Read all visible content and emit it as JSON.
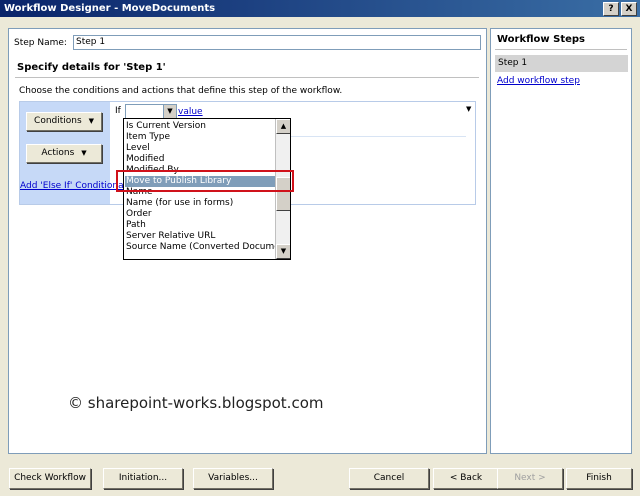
{
  "window": {
    "title": "Workflow Designer - MoveDocuments",
    "help_glyph": "?",
    "close_glyph": "X"
  },
  "step": {
    "name_label": "Step Name:",
    "name_value": "Step 1",
    "details_heading": "Specify details for 'Step 1'",
    "instructions": "Choose the conditions and actions that define this step of the workflow."
  },
  "condition": {
    "if_label": "If",
    "value_link": "value",
    "conditions_button": "Conditions",
    "actions_button": "Actions",
    "add_else_if": "Add 'Else If' Conditional Branch"
  },
  "dropdown": {
    "items": [
      "Is Current Version",
      "Item Type",
      "Level",
      "Modified",
      "Modified By",
      "Move to Publish Library",
      "Name",
      "Name (for use in forms)",
      "Order",
      "Path",
      "Server Relative URL",
      "Source Name (Converted Document)"
    ],
    "selected": "Move to Publish Library"
  },
  "sidebar": {
    "header": "Workflow Steps",
    "steps": [
      "Step 1"
    ],
    "add_link": "Add workflow step"
  },
  "watermark": "© sharepoint-works.blogspot.com",
  "footer": {
    "check_workflow": "Check Workflow",
    "initiation": "Initiation...",
    "variables": "Variables...",
    "cancel": "Cancel",
    "back": "< Back",
    "next": "Next >",
    "finish": "Finish"
  },
  "colors": {
    "highlight_border": "#d0121b",
    "condition_panel": "#c6d9f7",
    "title_bar": "#0a246a"
  }
}
